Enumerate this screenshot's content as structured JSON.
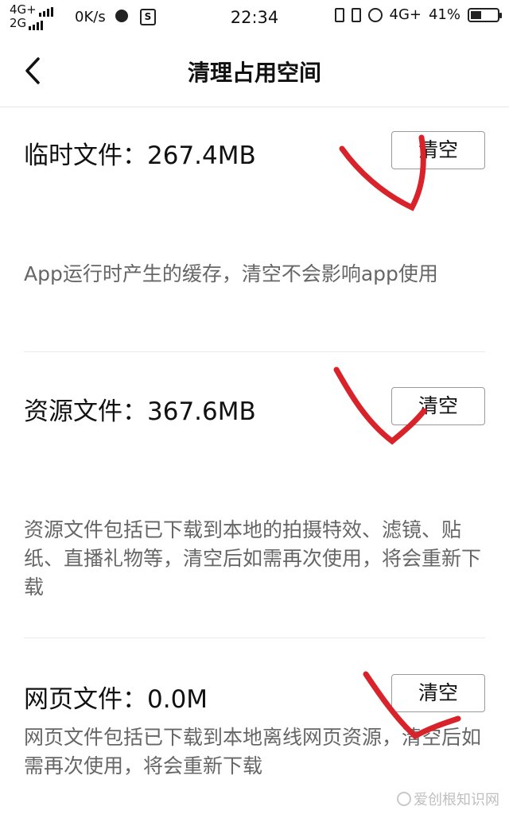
{
  "status_bar": {
    "net1": "4G+",
    "net2": "2G",
    "speed": "0K/s",
    "s_badge": "S",
    "time": "22:34",
    "net3": "4G+",
    "battery": "41%",
    "battery_level": 0.41
  },
  "header": {
    "title": "清理占用空间",
    "back_icon": "chevron-left-icon"
  },
  "sections": [
    {
      "title": "临时文件：267.4MB",
      "button": "清空",
      "description": "App运行时产生的缓存，清空不会影响app使用"
    },
    {
      "title": "资源文件：367.6MB",
      "button": "清空",
      "description": "资源文件包括已下载到本地的拍摄特效、滤镜、贴纸、直播礼物等，清空后如需再次使用，将会重新下载"
    },
    {
      "title": "网页文件：0.0M",
      "button": "清空",
      "description": "网页文件包括已下载到本地离线网页资源，清空后如需再次使用，将会重新下载"
    }
  ],
  "annotation_color": "#d9232b",
  "watermark": "爱创根知识网"
}
